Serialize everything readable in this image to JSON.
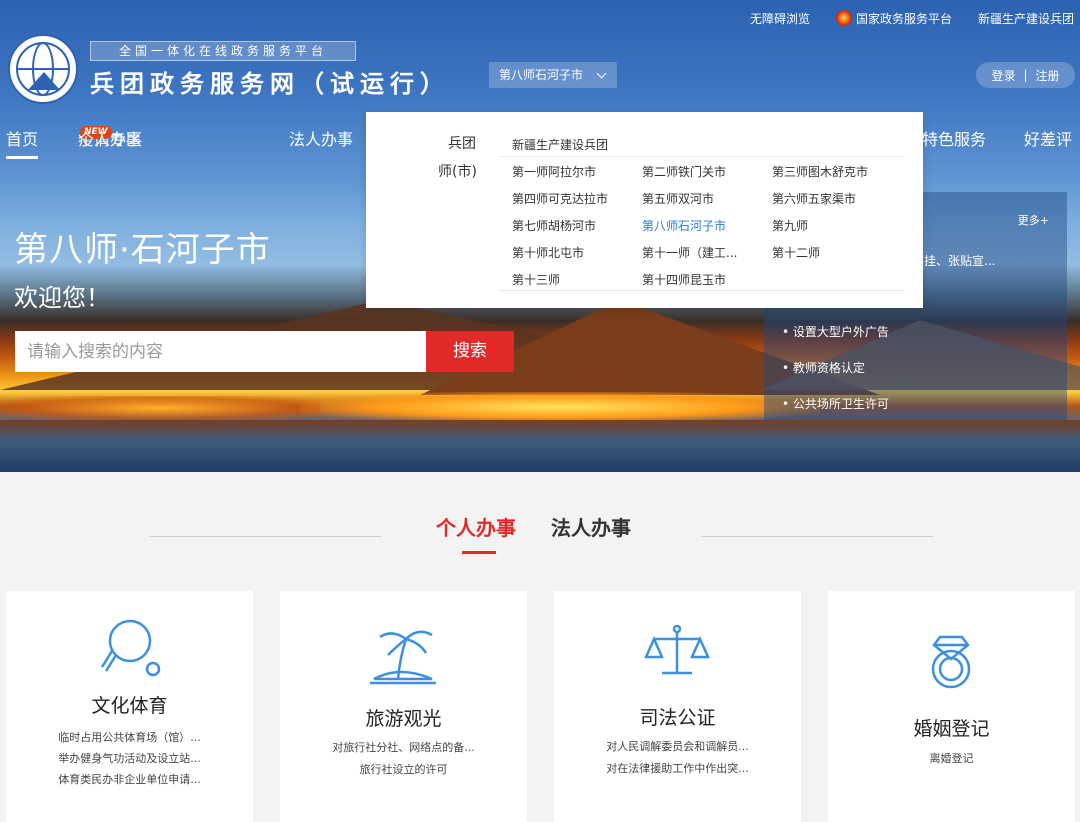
{
  "top_links": {
    "accessibility": "无障碍浏览",
    "national_platform": "国家政务服务平台",
    "bingtuan": "新疆生产建设兵团"
  },
  "header": {
    "platform_tag": "全国一体化在线政务服务平台",
    "site_title": "兵团政务服务网（试运行）",
    "city_select": "第八师石河子市",
    "login": "登录",
    "register": "注册",
    "login_sep": "|"
  },
  "nav": {
    "home": "首页",
    "epidemic": "疫情专区",
    "new_badge": "NEW",
    "personal": "个人办事",
    "legal": "法人办事",
    "special": "特色服务",
    "rating": "好差评"
  },
  "hero": {
    "city": "第八师·石河子市",
    "welcome": "欢迎您！",
    "search_placeholder": "请输入搜索的内容",
    "search_button": "搜索"
  },
  "hot_panel": {
    "more": "更多+",
    "items": [
      "挂、张贴宣...",
      "• 设置大型户外广告",
      "• 教师资格认定",
      "• 公共场所卫生许可"
    ]
  },
  "dropdown": {
    "cat_bingtuan": "兵团",
    "cat_division": "师(市)",
    "bingtuan_item": "新疆生产建设兵团",
    "divisions": [
      "第一师阿拉尔市",
      "第二师铁门关市",
      "第三师图木舒克市",
      "第四师可克达拉市",
      "第五师双河市",
      "第六师五家渠市",
      "第七师胡杨河市",
      "第八师石河子市",
      "第九师",
      "第十师北屯市",
      "第十一师（建工...",
      "第十二师",
      "第十三师",
      "第十四师昆玉市"
    ],
    "selected": "第八师石河子市"
  },
  "section": {
    "tab_personal": "个人办事",
    "tab_legal": "法人办事"
  },
  "cards": [
    {
      "icon": "ping-pong-icon",
      "title": "文化体育",
      "lines": [
        "临时占用公共体育场（馆）...",
        "举办健身气功活动及设立站...",
        "体育类民办非企业单位申请..."
      ]
    },
    {
      "icon": "palm-island-icon",
      "title": "旅游观光",
      "lines": [
        "对旅行社分社、网络点的备...",
        "旅行社设立的许可"
      ]
    },
    {
      "icon": "scales-icon",
      "title": "司法公证",
      "lines": [
        "对人民调解委员会和调解员...",
        "对在法律援助工作中作出突..."
      ]
    },
    {
      "icon": "diamond-ring-icon",
      "title": "婚姻登记",
      "lines": [
        "离婚登记"
      ]
    }
  ],
  "colors": {
    "brand_blue": "#2c62b0",
    "accent_red": "#e02a2a",
    "link_blue": "#2a7ad8",
    "icon_blue": "#3d8fe0"
  }
}
